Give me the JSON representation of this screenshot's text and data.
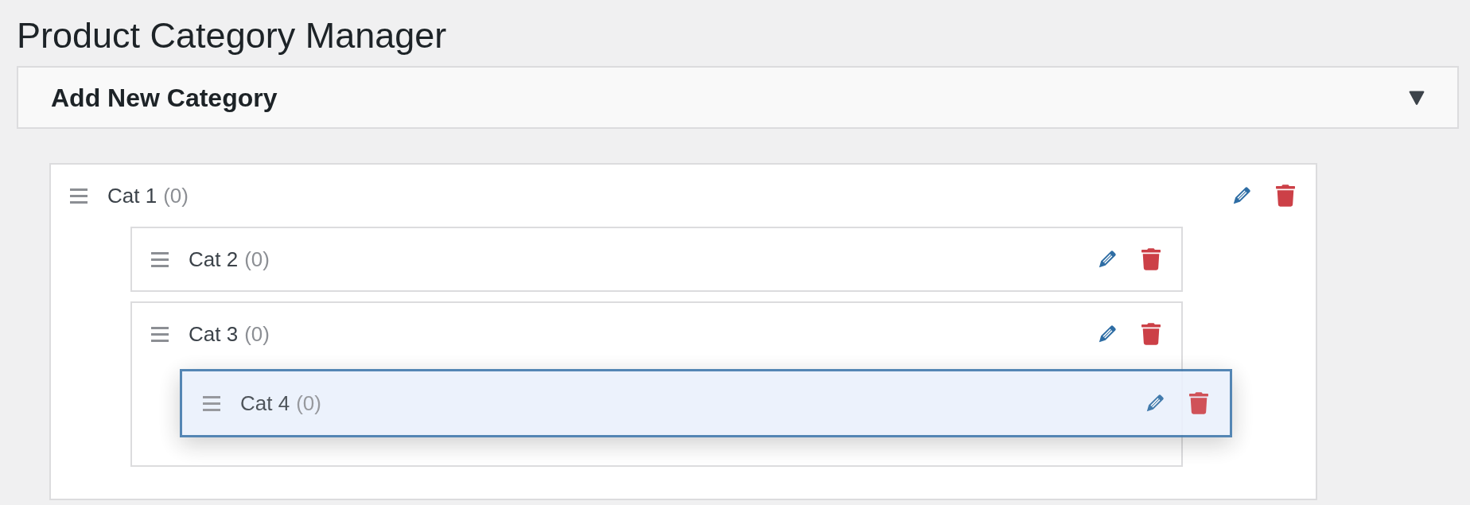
{
  "page": {
    "title": "Product Category Manager"
  },
  "add_panel": {
    "title": "Add New Category",
    "expanded": false
  },
  "categories": [
    {
      "name": "Cat 1",
      "count": "(0)",
      "dragging": false,
      "children": [
        {
          "name": "Cat 2",
          "count": "(0)",
          "dragging": false
        },
        {
          "name": "Cat 3",
          "count": "(0)",
          "dragging": false,
          "children": [
            {
              "name": "Cat 4",
              "count": "(0)",
              "dragging": true
            }
          ]
        }
      ]
    }
  ]
}
